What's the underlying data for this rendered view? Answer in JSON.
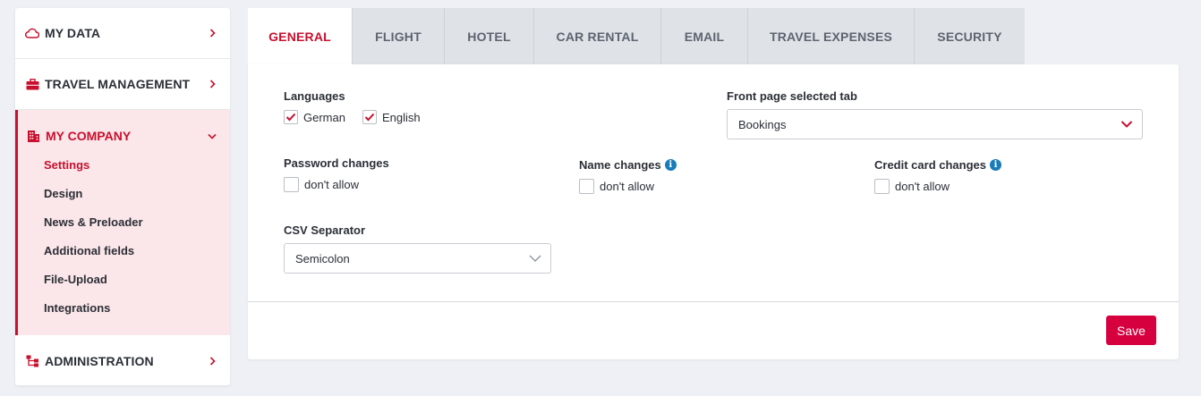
{
  "sidebar": {
    "items": [
      {
        "label": "MY DATA",
        "icon": "cloud-icon"
      },
      {
        "label": "TRAVEL MANAGEMENT",
        "icon": "briefcase-icon"
      },
      {
        "label": "MY COMPANY",
        "icon": "building-icon"
      },
      {
        "label": "ADMINISTRATION",
        "icon": "hierarchy-icon"
      }
    ],
    "company_subitems": [
      {
        "label": "Settings",
        "active": true
      },
      {
        "label": "Design"
      },
      {
        "label": "News & Preloader"
      },
      {
        "label": "Additional fields"
      },
      {
        "label": "File-Upload"
      },
      {
        "label": "Integrations"
      }
    ]
  },
  "tabs": [
    {
      "label": "GENERAL",
      "active": true
    },
    {
      "label": "FLIGHT"
    },
    {
      "label": "HOTEL"
    },
    {
      "label": "CAR RENTAL"
    },
    {
      "label": "EMAIL"
    },
    {
      "label": "TRAVEL EXPENSES"
    },
    {
      "label": "SECURITY"
    }
  ],
  "form": {
    "languages": {
      "label": "Languages",
      "options": [
        {
          "label": "German",
          "checked": true
        },
        {
          "label": "English",
          "checked": true
        }
      ]
    },
    "front_page_tab": {
      "label": "Front page selected tab",
      "value": "Bookings"
    },
    "password_changes": {
      "label": "Password changes",
      "option": "don't allow",
      "checked": false
    },
    "name_changes": {
      "label": "Name changes",
      "option": "don't allow",
      "checked": false,
      "info": "i"
    },
    "credit_card_changes": {
      "label": "Credit card changes",
      "option": "don't allow",
      "checked": false,
      "info": "i"
    },
    "csv_separator": {
      "label": "CSV Separator",
      "value": "Semicolon"
    }
  },
  "save_label": "Save",
  "colors": {
    "accent": "#c8102e",
    "save_button": "#d6003f",
    "info": "#1a7bb9",
    "tab_inactive_bg": "#dfe2e6",
    "page_bg": "#eef0f5",
    "active_section_bg": "#fbe6e9"
  }
}
